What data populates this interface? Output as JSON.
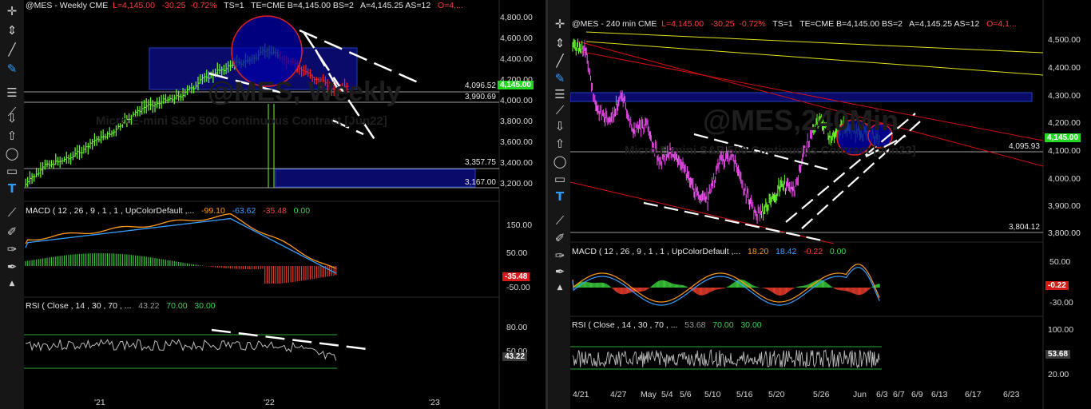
{
  "left": {
    "header": {
      "sym": "@MES - Weekly  CME",
      "last": "L=4,145.00",
      "chg": "-30.25",
      "pct": "-0.72%",
      "ts": "TS=1",
      "te": "TE=CME  B=4,145.00  BS=2",
      "ask": "A=4,145.25  AS=12",
      "open": "O=4,..."
    },
    "watermark": "@MES, Weekly",
    "watermark_sub": "Micro E-mini S&P 500 Continuous Contract [Jun22]",
    "price_axis": [
      "4,800.00",
      "4,600.00",
      "4,400.00",
      "4,200.00",
      "4,000.00",
      "3,800.00",
      "3,600.00",
      "3,400.00",
      "3,200.00"
    ],
    "levels": [
      "4,096.52",
      "3,990.69",
      "3,357.75",
      "3,167.00"
    ],
    "price_tag": "4,145.00",
    "macd": {
      "title": "MACD ( 12 , 26 , 9 , 1 , 1 , UpColorDefault ,...",
      "v1": "-99.10",
      "v2": "-63.62",
      "v3": "-35.48",
      "v4": "0.00",
      "axis": [
        "150.00",
        "50.00",
        "-50.00"
      ],
      "tag": "-35.48"
    },
    "rsi": {
      "title": "RSI ( Close , 14 , 30 , 70 , ...",
      "v1": "43.22",
      "v2": "70.00",
      "v3": "30.00",
      "axis": [
        "80.00",
        "50.00"
      ],
      "tag": "43.22"
    },
    "xaxis": [
      "'21",
      "'22",
      "'23"
    ]
  },
  "right": {
    "header": {
      "sym": "@MES - 240 min  CME",
      "last": "L=4,145.00",
      "chg": "-30.25",
      "pct": "-0.72%",
      "ts": "TS=1",
      "te": "TE=CME  B=4,145.00  BS=2",
      "ask": "A=4,145.25  AS=12",
      "open": "O=4,1..."
    },
    "watermark": "@MES,240Min",
    "watermark_sub": "Micro E-mini S&P 500 Continuous Contract [Jun22]",
    "price_axis": [
      "4,500.00",
      "4,400.00",
      "4,300.00",
      "4,200.00",
      "4,100.00",
      "4,000.00",
      "3,900.00",
      "3,800.00"
    ],
    "levels": [
      "4,095.93",
      "3,804.12"
    ],
    "price_tag": "4,145.00",
    "macd": {
      "title": "MACD ( 12 , 26 , 9 , 1 , 1 , UpColorDefault ,...",
      "v1": "18.20",
      "v2": "18.42",
      "v3": "-0.22",
      "v4": "0.00",
      "axis": [
        "50.00",
        "-30.00"
      ],
      "tag": "-0.22"
    },
    "rsi": {
      "title": "RSI ( Close , 14 , 30 , 70 , ...",
      "v1": "53.68",
      "v2": "70.00",
      "v3": "30.00",
      "axis": [
        "100.00",
        "20.00"
      ],
      "tag": "53.68"
    },
    "xaxis": [
      "4/21",
      "4/27",
      "May",
      "5/4",
      "5/6",
      "5/10",
      "5/16",
      "5/20",
      "5/26",
      "Jun",
      "6/3",
      "6/7",
      "6/9",
      "6/13",
      "6/17",
      "6/23"
    ]
  },
  "colors": {
    "bull": "#6bff2e",
    "bear": "#ff2020",
    "magenta": "#e040e0",
    "zone": "#0a0a6a",
    "macd_up": "#39c639",
    "macd_dn": "#e23a2a"
  },
  "toolbar_icons": [
    "crosshair-icon",
    "arrow-up-down-icon",
    "line-icon",
    "pencil-icon",
    "horizontal-lines-icon",
    "trendline-icon",
    "up-arrow-icon",
    "down-arrow-icon",
    "up-arrow-outline-icon",
    "circle-icon",
    "rectangle-icon",
    "text-icon",
    "ray-icon",
    "fib-icon",
    "pen-icon",
    "marker-icon",
    "collapse-icon"
  ]
}
